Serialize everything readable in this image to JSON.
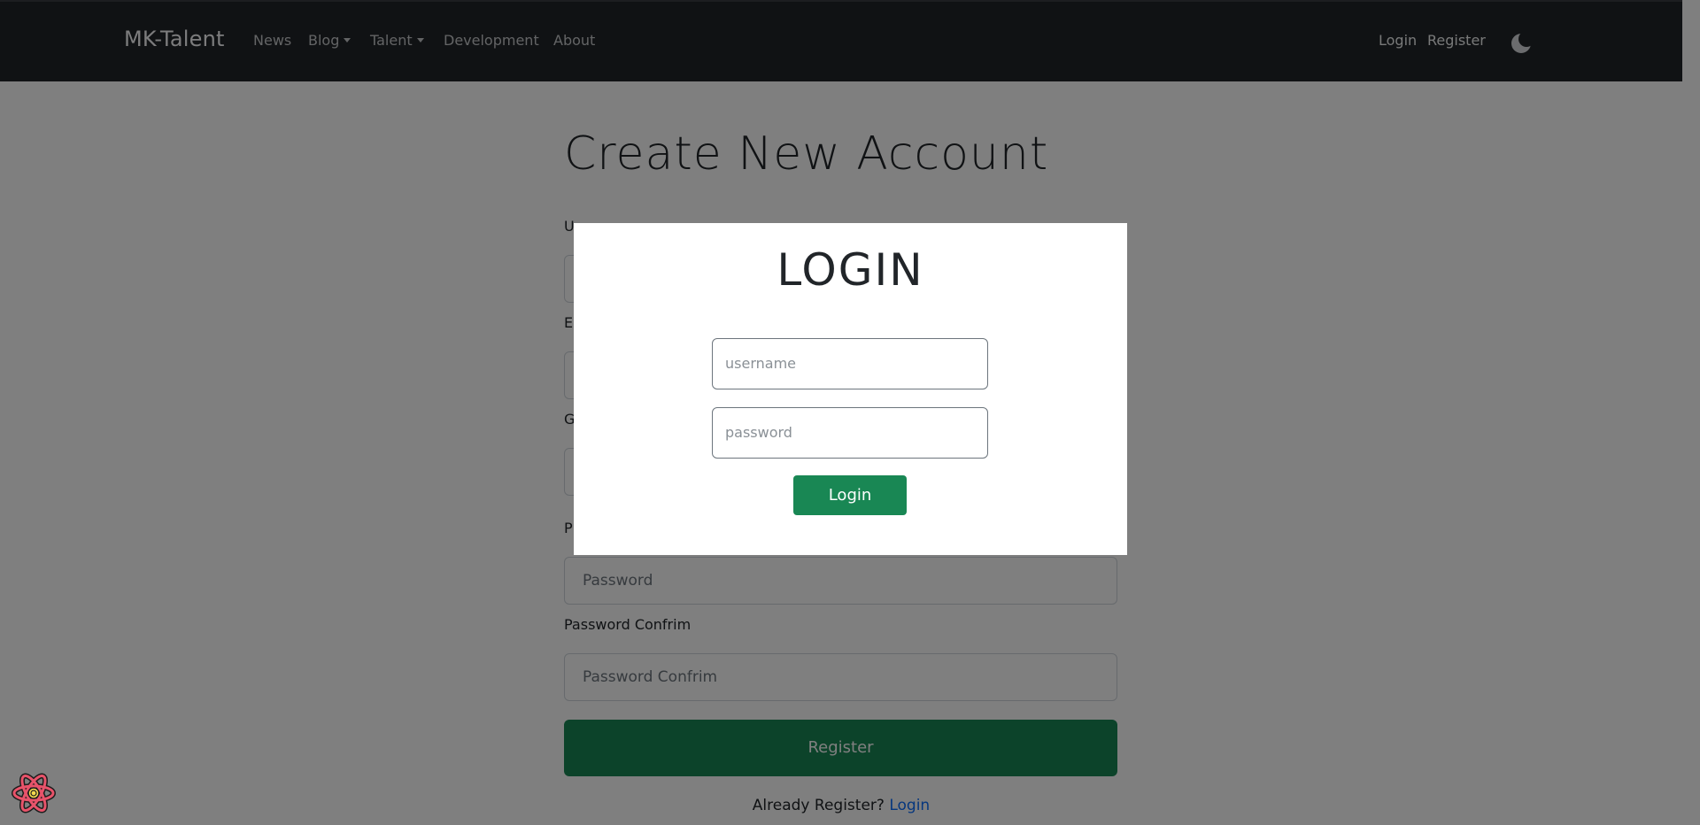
{
  "navbar": {
    "brand": "MK-Talent",
    "links": [
      "News",
      "Blog",
      "Talent",
      "Development",
      "About"
    ],
    "login": "Login",
    "register": "Register",
    "theme_icon": "moon-icon"
  },
  "form": {
    "title": "Create New Account",
    "password_label": "P",
    "password_placeholder": "Password",
    "password_confirm_label": "Password Confrim",
    "password_confirm_placeholder": "Password Confrim",
    "register_button": "Register",
    "already_text": "Already Register?",
    "login_link": "Login",
    "hidden_label_initials": [
      "U",
      "E",
      "G"
    ]
  },
  "modal": {
    "title": "LOGIN",
    "username_placeholder": "username",
    "password_placeholder": "password",
    "login_button": "Login"
  },
  "colors": {
    "navbar_bg": "#212529",
    "success": "#198754",
    "link": "#0d6efd"
  },
  "devtools_icon": "react-logo-icon"
}
